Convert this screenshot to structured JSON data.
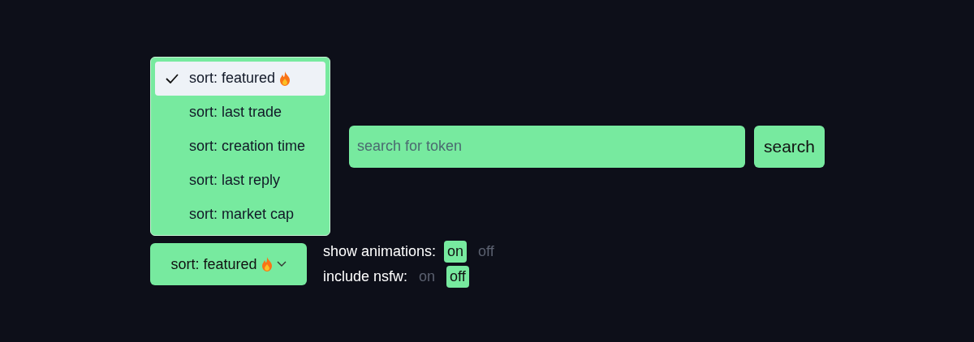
{
  "sort_menu": {
    "open": true,
    "items": [
      {
        "label": "sort: featured",
        "fire": true,
        "selected": true
      },
      {
        "label": "sort: last trade",
        "fire": false,
        "selected": false
      },
      {
        "label": "sort: creation time",
        "fire": false,
        "selected": false
      },
      {
        "label": "sort: last reply",
        "fire": false,
        "selected": false
      },
      {
        "label": "sort: market cap",
        "fire": false,
        "selected": false
      }
    ]
  },
  "search": {
    "placeholder": "search for token",
    "button": "search"
  },
  "sort_button": {
    "label": "sort: featured",
    "fire": true
  },
  "toggles": [
    {
      "label": "show animations:",
      "options": [
        {
          "label": "on",
          "selected": true
        },
        {
          "label": "off",
          "selected": false
        }
      ]
    },
    {
      "label": "include nsfw:",
      "options": [
        {
          "label": "on",
          "selected": false
        },
        {
          "label": "off",
          "selected": true
        }
      ]
    }
  ]
}
